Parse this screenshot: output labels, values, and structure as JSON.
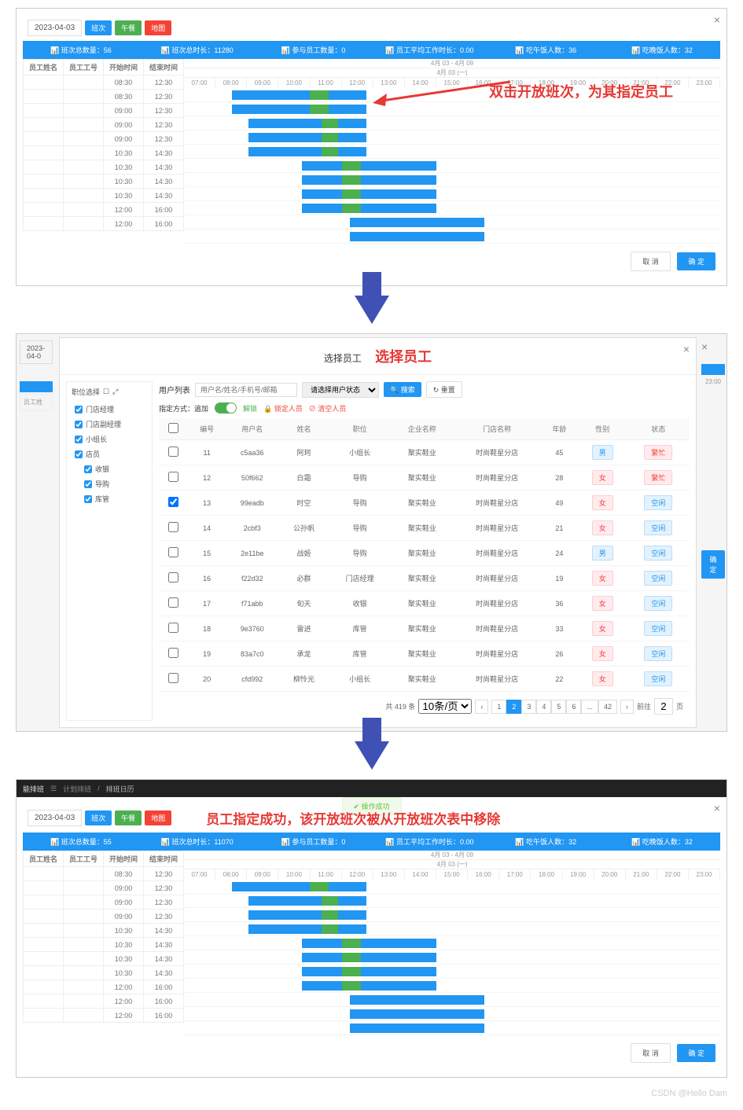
{
  "date": "2023-04-03",
  "btns": {
    "view": "班次",
    "lunch": "午餐",
    "map": "地图"
  },
  "annot1": "双击开放班次，为其指定员工",
  "annot2": "选择员工",
  "annot3": "员工指定成功，该开放班次被从开放班次表中移除",
  "modalTitle": "选择员工",
  "stats1": [
    "班次总数量：56",
    "班次总时长：11280",
    "参与员工数量：0",
    "员工平均工作时长：0.00",
    "吃午饭人数：36",
    "吃晚饭人数：32"
  ],
  "stats3": [
    "班次总数量：55",
    "班次总时长：11070",
    "参与员工数量：0",
    "员工平均工作时长：0.00",
    "吃午饭人数：32",
    "吃晚饭人数：32"
  ],
  "ganttCols": [
    "员工姓名",
    "员工工号",
    "开始时间",
    "结束时间"
  ],
  "ganttHeader": "4月 03 - 4月 09",
  "ganttSub": "4月 03 (一)",
  "hours": [
    "07:00",
    "08:00",
    "09:00",
    "10:00",
    "11:00",
    "12:00",
    "13:00",
    "14:00",
    "15:00",
    "16:00",
    "17:00",
    "18:00",
    "19:00",
    "20:00",
    "21:00",
    "22:00",
    "23:00"
  ],
  "shifts1": [
    {
      "start": "08:30",
      "end": "12:30",
      "pos": 9,
      "len": 25,
      "lunch": 58
    },
    {
      "start": "08:30",
      "end": "12:30",
      "pos": 9,
      "len": 25,
      "lunch": 58
    },
    {
      "start": "09:00",
      "end": "12:30",
      "pos": 12,
      "len": 22,
      "lunch": 62
    },
    {
      "start": "09:00",
      "end": "12:30",
      "pos": 12,
      "len": 22,
      "lunch": 62
    },
    {
      "start": "09:00",
      "end": "12:30",
      "pos": 12,
      "len": 22,
      "lunch": 62
    },
    {
      "start": "10:30",
      "end": "14:30",
      "pos": 22,
      "len": 25,
      "lunch": 30
    },
    {
      "start": "10:30",
      "end": "14:30",
      "pos": 22,
      "len": 25,
      "lunch": 30
    },
    {
      "start": "10:30",
      "end": "14:30",
      "pos": 22,
      "len": 25,
      "lunch": 30
    },
    {
      "start": "10:30",
      "end": "14:30",
      "pos": 22,
      "len": 25,
      "lunch": 30
    },
    {
      "start": "12:00",
      "end": "16:00",
      "pos": 31,
      "len": 25,
      "lunch": -1
    },
    {
      "start": "12:00",
      "end": "16:00",
      "pos": 31,
      "len": 25,
      "lunch": -1
    }
  ],
  "shifts3": [
    {
      "start": "08:30",
      "end": "12:30",
      "pos": 9,
      "len": 25,
      "lunch": 58
    },
    {
      "start": "09:00",
      "end": "12:30",
      "pos": 12,
      "len": 22,
      "lunch": 62
    },
    {
      "start": "09:00",
      "end": "12:30",
      "pos": 12,
      "len": 22,
      "lunch": 62
    },
    {
      "start": "09:00",
      "end": "12:30",
      "pos": 12,
      "len": 22,
      "lunch": 62
    },
    {
      "start": "10:30",
      "end": "14:30",
      "pos": 22,
      "len": 25,
      "lunch": 30
    },
    {
      "start": "10:30",
      "end": "14:30",
      "pos": 22,
      "len": 25,
      "lunch": 30
    },
    {
      "start": "10:30",
      "end": "14:30",
      "pos": 22,
      "len": 25,
      "lunch": 30
    },
    {
      "start": "10:30",
      "end": "14:30",
      "pos": 22,
      "len": 25,
      "lunch": 30
    },
    {
      "start": "12:00",
      "end": "16:00",
      "pos": 31,
      "len": 25,
      "lunch": -1
    },
    {
      "start": "12:00",
      "end": "16:00",
      "pos": 31,
      "len": 25,
      "lunch": -1
    },
    {
      "start": "12:00",
      "end": "16:00",
      "pos": 31,
      "len": 25,
      "lunch": -1
    }
  ],
  "footer": {
    "cancel": "取 消",
    "ok": "确 定"
  },
  "tree": {
    "title": "职位选择",
    "items": [
      "门店经理",
      "门店副经理",
      "小组长",
      "店员",
      "收银",
      "导购",
      "库管"
    ]
  },
  "userFilter": {
    "label": "用户列表",
    "placeholder": "用户名/姓名/手机号/邮箱",
    "status": "请选择用户状态",
    "search": "搜索",
    "reset": "重置"
  },
  "lockRow": {
    "label": "指定方式：追加",
    "unlock": "解锁",
    "lockPeople": "锁定人员",
    "clearPeople": "清空人员"
  },
  "userCols": [
    "",
    "编号",
    "用户名",
    "姓名",
    "职位",
    "企业名称",
    "门店名称",
    "年龄",
    "性别",
    "状态"
  ],
  "users": [
    {
      "n": "11",
      "u": "c5aa36",
      "name": "阿珂",
      "role": "小组长",
      "corp": "聚实鞋业",
      "store": "时尚鞋星分店",
      "age": "45",
      "sex": "男",
      "st": "繁忙"
    },
    {
      "n": "12",
      "u": "50f662",
      "name": "白霜",
      "role": "导购",
      "corp": "聚实鞋业",
      "store": "时尚鞋星分店",
      "age": "28",
      "sex": "女",
      "st": "繁忙"
    },
    {
      "n": "13",
      "u": "99eadb",
      "name": "时空",
      "role": "导购",
      "corp": "聚实鞋业",
      "store": "时尚鞋星分店",
      "age": "49",
      "sex": "女",
      "st": "空闲",
      "chk": true
    },
    {
      "n": "14",
      "u": "2cbf3",
      "name": "公孙帆",
      "role": "导购",
      "corp": "聚实鞋业",
      "store": "时尚鞋星分店",
      "age": "21",
      "sex": "女",
      "st": "空闲"
    },
    {
      "n": "15",
      "u": "2e11be",
      "name": "战姬",
      "role": "导购",
      "corp": "聚实鞋业",
      "store": "时尚鞋星分店",
      "age": "24",
      "sex": "男",
      "st": "空闲"
    },
    {
      "n": "16",
      "u": "f22d32",
      "name": "必群",
      "role": "门店经理",
      "corp": "聚实鞋业",
      "store": "时尚鞋星分店",
      "age": "19",
      "sex": "女",
      "st": "空闲"
    },
    {
      "n": "17",
      "u": "f71abb",
      "name": "旬天",
      "role": "收银",
      "corp": "聚实鞋业",
      "store": "时尚鞋星分店",
      "age": "36",
      "sex": "女",
      "st": "空闲"
    },
    {
      "n": "18",
      "u": "9e3760",
      "name": "雷进",
      "role": "库管",
      "corp": "聚实鞋业",
      "store": "时尚鞋星分店",
      "age": "33",
      "sex": "女",
      "st": "空闲"
    },
    {
      "n": "19",
      "u": "83a7c0",
      "name": "承龙",
      "role": "库管",
      "corp": "聚实鞋业",
      "store": "时尚鞋星分店",
      "age": "26",
      "sex": "女",
      "st": "空闲"
    },
    {
      "n": "20",
      "u": "cfd992",
      "name": "柳怜光",
      "role": "小组长",
      "corp": "聚实鞋业",
      "store": "时尚鞋星分店",
      "age": "22",
      "sex": "女",
      "st": "空闲"
    }
  ],
  "pager": {
    "total": "共 419 条",
    "size": "10条/页",
    "pages": [
      "1",
      "2",
      "3",
      "4",
      "5",
      "6",
      "...",
      "42"
    ],
    "goto": "前往",
    "page": "2",
    "unit": "页"
  },
  "toast": "操作成功",
  "breadcrumb": {
    "a": "计划排班",
    "b": "排班日历"
  },
  "logo": "能排班",
  "watermark": "CSDN @Hello Dam"
}
